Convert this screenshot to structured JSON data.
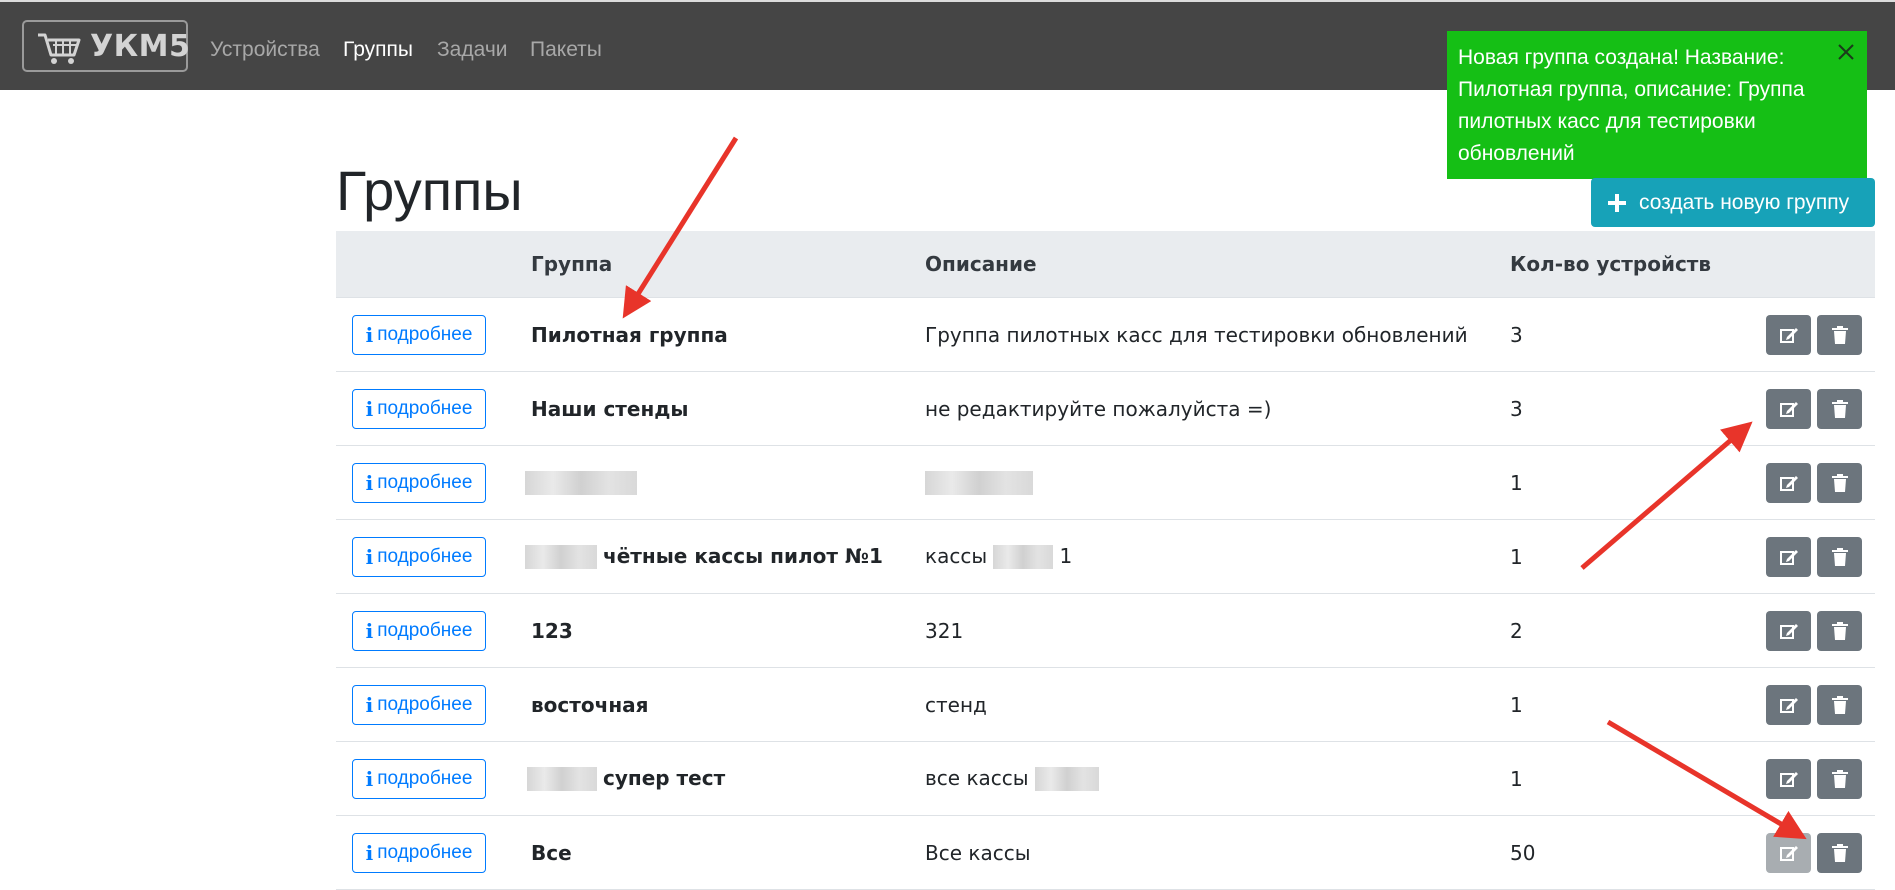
{
  "navbar": {
    "brand": "УКМ5",
    "links": [
      "Устройства",
      "Группы",
      "Задачи",
      "Пакеты"
    ],
    "active_index": 1
  },
  "toast": {
    "message": "Новая группа создана! Название: Пилотная группа, описание: Группа пилотных касс для тестировки обновлений",
    "close_icon": "close-icon"
  },
  "page": {
    "title": "Группы",
    "create_button": "создать новую группу"
  },
  "table": {
    "headers": {
      "group": "Группа",
      "description": "Описание",
      "count": "Кол-во устройств"
    },
    "info_label": "подробнее",
    "rows": [
      {
        "name": "Пилотная группа",
        "description": "Группа пилотных касс для тестировки обновлений",
        "count": "3"
      },
      {
        "name": "Наши стенды",
        "description": "не редактируйте пожалуйста =)",
        "count": "3"
      },
      {
        "name": "",
        "description": "",
        "count": "1"
      },
      {
        "name": "чётные кассы пилот №1",
        "description": "кассы",
        "description_suffix": "1",
        "count": "1"
      },
      {
        "name": "123",
        "description": "321",
        "count": "2"
      },
      {
        "name": "восточная",
        "description": "стенд",
        "count": "1"
      },
      {
        "name": "супер тест",
        "description": "все кассы",
        "count": "1"
      },
      {
        "name": "Все",
        "description": "Все кассы",
        "count": "50"
      }
    ]
  },
  "colors": {
    "navbar": "#454545",
    "toast": "#15bf15",
    "create_button": "#17a2b8",
    "action_button": "#6c757d",
    "info_button": "#007bff",
    "annotation_arrow": "#e8342a"
  }
}
